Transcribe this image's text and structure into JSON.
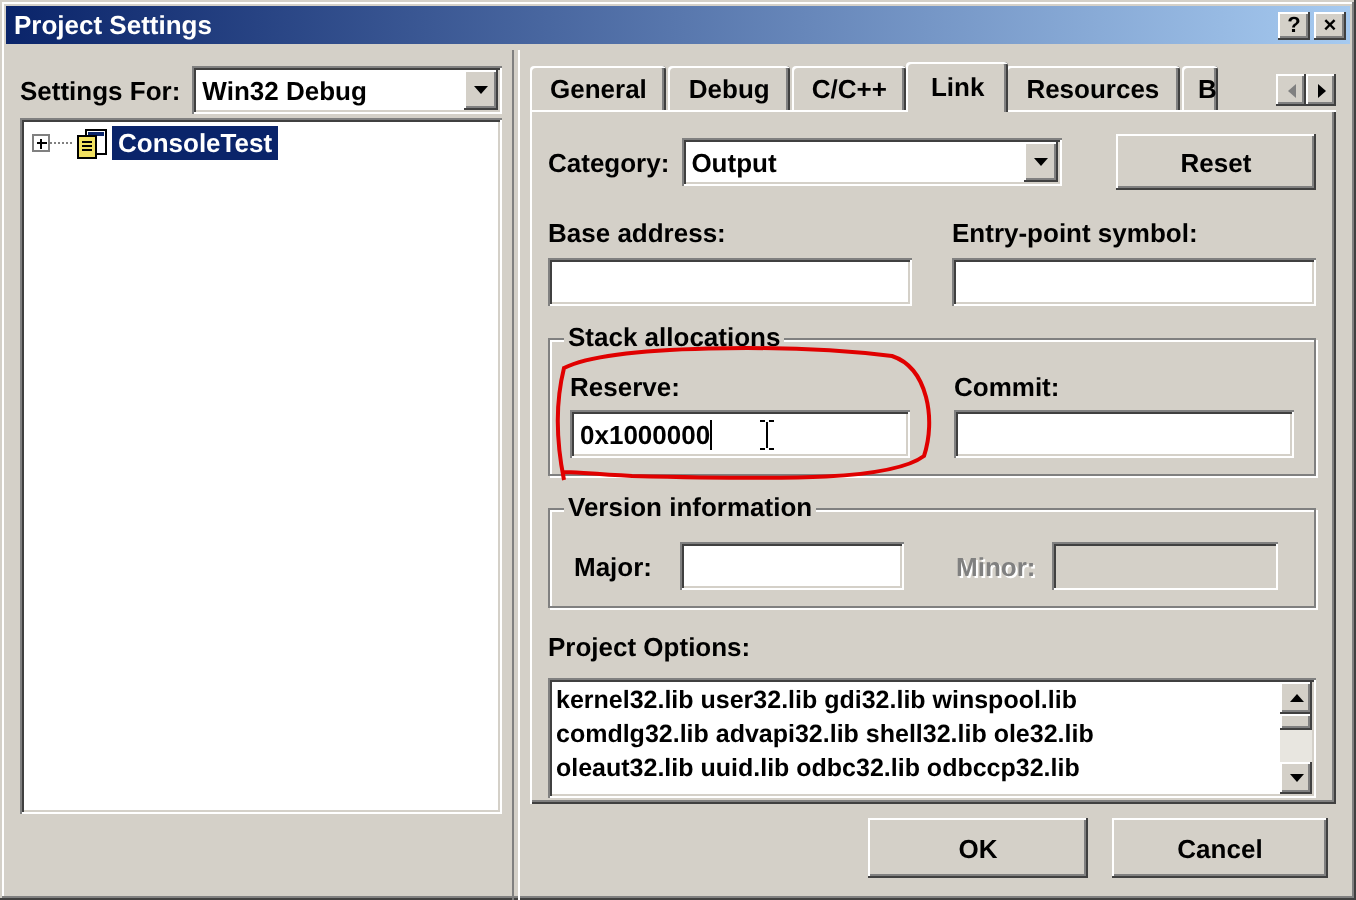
{
  "window": {
    "title": "Project Settings",
    "controls": [
      "?",
      "×"
    ]
  },
  "settings_for": {
    "label": "Settings For:",
    "value": "Win32 Debug"
  },
  "tree": [
    {
      "label": "ConsoleTest",
      "selected": true,
      "expanded": false
    }
  ],
  "tabs": [
    {
      "label": "General",
      "selected": false
    },
    {
      "label": "Debug",
      "selected": false
    },
    {
      "label": "C/C++",
      "selected": false
    },
    {
      "label": "Link",
      "selected": true
    },
    {
      "label": "Resources",
      "selected": false
    },
    {
      "label": "B",
      "selected": false
    }
  ],
  "category": {
    "label": "Category:",
    "value": "Output"
  },
  "reset_button": "Reset",
  "base_address": {
    "label": "Base address:"
  },
  "entry_point": {
    "label": "Entry-point symbol:"
  },
  "stack_allocations": {
    "title": "Stack allocations",
    "reserve": {
      "label": "Reserve:",
      "value": "0x1000000"
    },
    "commit": {
      "label": "Commit:"
    }
  },
  "version_information": {
    "title": "Version information",
    "major": {
      "label": "Major:",
      "disabled": false
    },
    "minor": {
      "label": "Minor:",
      "disabled": true
    }
  },
  "project_options": {
    "label": "Project Options:",
    "lines": [
      "kernel32.lib user32.lib gdi32.lib winspool.lib",
      "comdlg32.lib advapi32.lib shell32.lib ole32.lib",
      "oleaut32.lib uuid.lib odbc32.lib odbccp32.lib"
    ]
  },
  "buttons": [
    "OK",
    "Cancel"
  ]
}
